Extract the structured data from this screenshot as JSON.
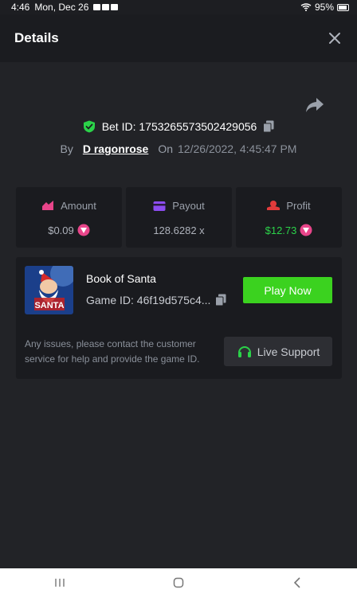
{
  "status_bar": {
    "time": "4:46",
    "date": "Mon, Dec 26",
    "battery": "95%"
  },
  "header": {
    "title": "Details"
  },
  "bet": {
    "bet_id_label": "Bet ID: 1753265573502429056",
    "by_label": "By",
    "user": "D ragonrose",
    "on_label": "On",
    "date": "12/26/2022, 4:45:47 PM"
  },
  "stats": [
    {
      "label": "Amount",
      "value": "$0.09",
      "icon": "amount-icon",
      "color": "#e8458a"
    },
    {
      "label": "Payout",
      "value": "128.6282 x",
      "icon": "payout-icon",
      "color": "#8c4cf0"
    },
    {
      "label": "Profit",
      "value": "$12.73",
      "icon": "profit-icon",
      "color": "#e23b3b"
    }
  ],
  "game": {
    "thumb_text": "SANTA",
    "title": "Book of Santa",
    "game_id": "Game ID: 46f19d575c4...",
    "play_label": "Play Now",
    "support_text": "Any issues, please contact the customer service for help and provide the game ID.",
    "support_label": "Live Support"
  },
  "colors": {
    "accent_green": "#3bd21f",
    "profit_green": "#2bd249",
    "shield_green": "#2bd249",
    "coin_pink": "#e8458a"
  }
}
